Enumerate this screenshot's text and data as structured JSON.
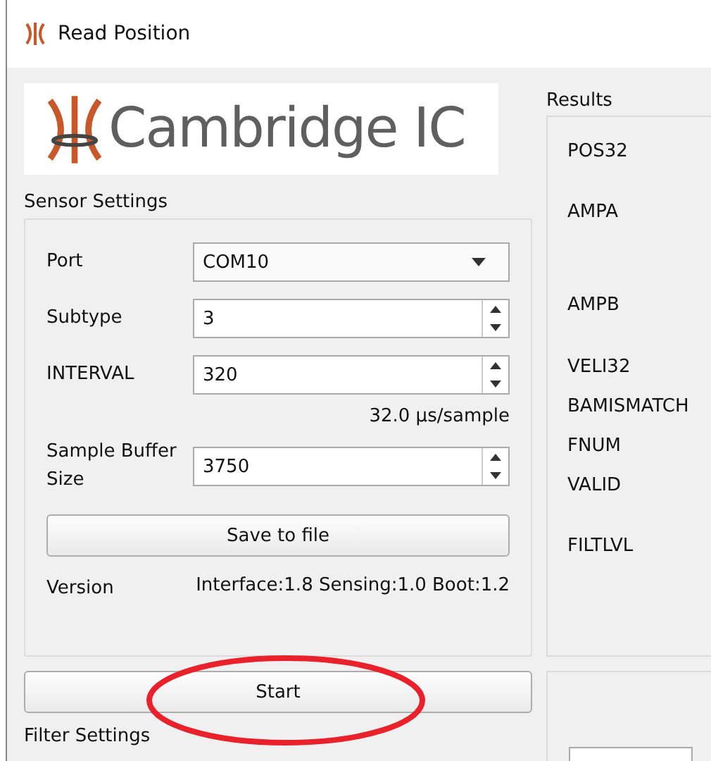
{
  "window": {
    "title": "Read Position"
  },
  "logo": {
    "text": "Cambridge IC"
  },
  "sensor_settings": {
    "title": "Sensor Settings",
    "fields": [
      {
        "kind": "combo",
        "label": "Port",
        "value": "COM10"
      },
      {
        "kind": "spin",
        "label": "Subtype",
        "value": "3"
      },
      {
        "kind": "spin",
        "label": "INTERVAL",
        "value": "320"
      },
      {
        "kind": "note",
        "value": "32.0 µs/sample"
      },
      {
        "kind": "spin",
        "label": "Sample Buffer Size",
        "value": "3750"
      }
    ],
    "save_button": "Save to file",
    "version": {
      "label": "Version",
      "value": "Interface:1.8 Sensing:1.0 Boot:1.2"
    }
  },
  "start_button": "Start",
  "filter_settings": {
    "title": "Filter Settings"
  },
  "results": {
    "title": "Results",
    "labels": [
      "POS32",
      "AMPA",
      "AMPB",
      "VELI32",
      "BAMISMATCH",
      "FNUM",
      "VALID",
      "FILTLVL"
    ]
  },
  "annotations": [
    {
      "kind": "ellipse",
      "color": "#e8212b"
    }
  ]
}
